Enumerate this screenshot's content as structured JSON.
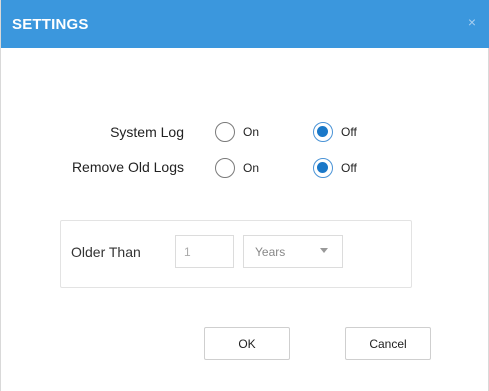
{
  "dialog": {
    "title": "SETTINGS",
    "close_glyph": "×",
    "title_bar_color": "#3b97dd"
  },
  "system_log": {
    "label": "System Log",
    "options": [
      {
        "label": "On",
        "selected": false
      },
      {
        "label": "Off",
        "selected": true
      }
    ]
  },
  "remove_old_logs": {
    "label": "Remove Old Logs",
    "options": [
      {
        "label": "On",
        "selected": false
      },
      {
        "label": "Off",
        "selected": true
      }
    ]
  },
  "older_than": {
    "label": "Older Than",
    "value": "1",
    "unit_selected": "Years"
  },
  "buttons": {
    "ok": "OK",
    "cancel": "Cancel"
  }
}
